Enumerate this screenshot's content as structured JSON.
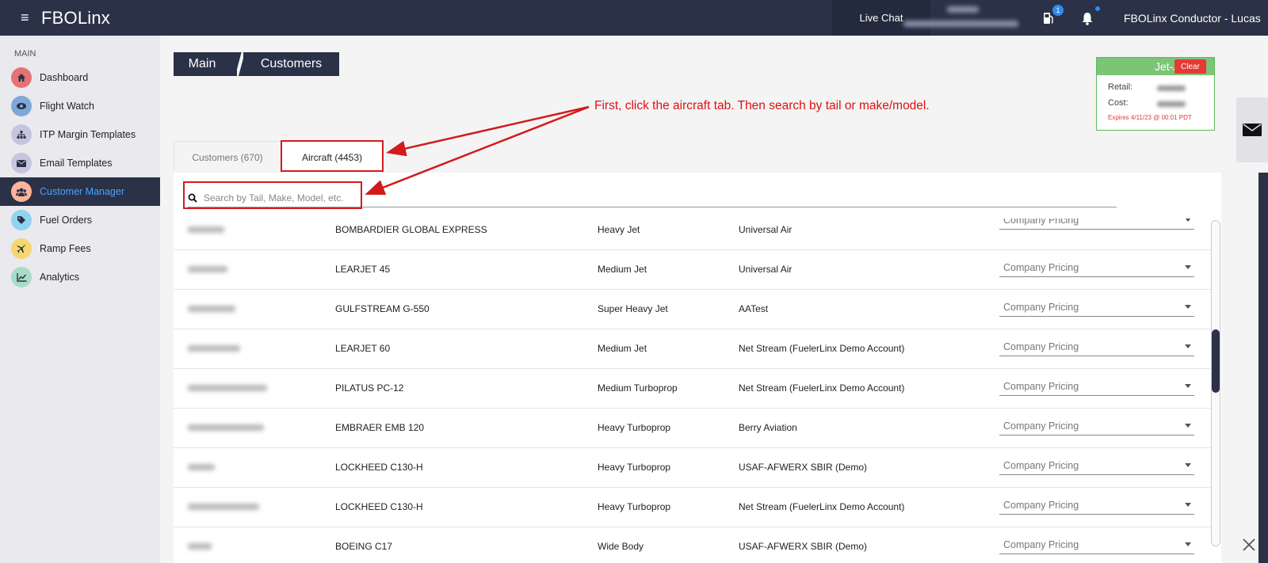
{
  "topbar": {
    "brand": "FBOLinx",
    "live_chat": "Live Chat",
    "fuel_badge_count": "1",
    "username": "FBOLinx Conductor - Lucas"
  },
  "sidebar": {
    "section": "MAIN",
    "items": [
      {
        "label": "Dashboard",
        "icon": "home-icon",
        "color": "#e57373"
      },
      {
        "label": "Flight Watch",
        "icon": "eye-icon",
        "color": "#7fa8d8"
      },
      {
        "label": "ITP Margin Templates",
        "icon": "sitemap-icon",
        "color": "#c5c5e0"
      },
      {
        "label": "Email Templates",
        "icon": "envelope-icon",
        "color": "#c5c5e0"
      },
      {
        "label": "Customer Manager",
        "icon": "users-icon",
        "color": "#ffb49a"
      },
      {
        "label": "Fuel Orders",
        "icon": "tag-icon",
        "color": "#8fd3f0"
      },
      {
        "label": "Ramp Fees",
        "icon": "plane-icon",
        "color": "#f5d76e"
      },
      {
        "label": "Analytics",
        "icon": "chart-icon",
        "color": "#a8dcc8"
      }
    ],
    "active_index": 4
  },
  "breadcrumb": {
    "main": "Main",
    "current": "Customers"
  },
  "jet_card": {
    "title": "Jet-A",
    "clear": "Clear",
    "retail_label": "Retail:",
    "cost_label": "Cost:",
    "expires": "Expires 4/11/23 @ 00:01 PDT",
    "accent": "#7cc576"
  },
  "annotation": {
    "text": "First, click the aircraft tab. Then search by tail or make/model.",
    "color": "#e01010"
  },
  "tabs": {
    "customers": "Customers (670)",
    "aircraft": "Aircraft (4453)"
  },
  "search": {
    "placeholder": "Search by Tail, Make, Model, etc."
  },
  "rows": [
    {
      "model": "BOMBARDIER GLOBAL EXPRESS",
      "size": "Heavy Jet",
      "company": "Universal Air",
      "pricing": "Company Pricing"
    },
    {
      "model": "LEARJET 45",
      "size": "Medium Jet",
      "company": "Universal Air",
      "pricing": "Company Pricing"
    },
    {
      "model": "GULFSTREAM G-550",
      "size": "Super Heavy Jet",
      "company": "AATest",
      "pricing": "Company Pricing"
    },
    {
      "model": "LEARJET 60",
      "size": "Medium Jet",
      "company": "Net Stream (FuelerLinx Demo Account)",
      "pricing": "Company Pricing"
    },
    {
      "model": "PILATUS PC-12",
      "size": "Medium Turboprop",
      "company": "Net Stream (FuelerLinx Demo Account)",
      "pricing": "Company Pricing"
    },
    {
      "model": "EMBRAER EMB 120",
      "size": "Heavy Turboprop",
      "company": "Berry Aviation",
      "pricing": "Company Pricing"
    },
    {
      "model": "LOCKHEED C130-H",
      "size": "Heavy Turboprop",
      "company": "USAF-AFWERX SBIR (Demo)",
      "pricing": "Company Pricing"
    },
    {
      "model": "LOCKHEED C130-H",
      "size": "Heavy Turboprop",
      "company": "Net Stream (FuelerLinx Demo Account)",
      "pricing": "Company Pricing"
    },
    {
      "model": "BOEING C17",
      "size": "Wide Body",
      "company": "USAF-AFWERX SBIR (Demo)",
      "pricing": "Company Pricing"
    }
  ]
}
